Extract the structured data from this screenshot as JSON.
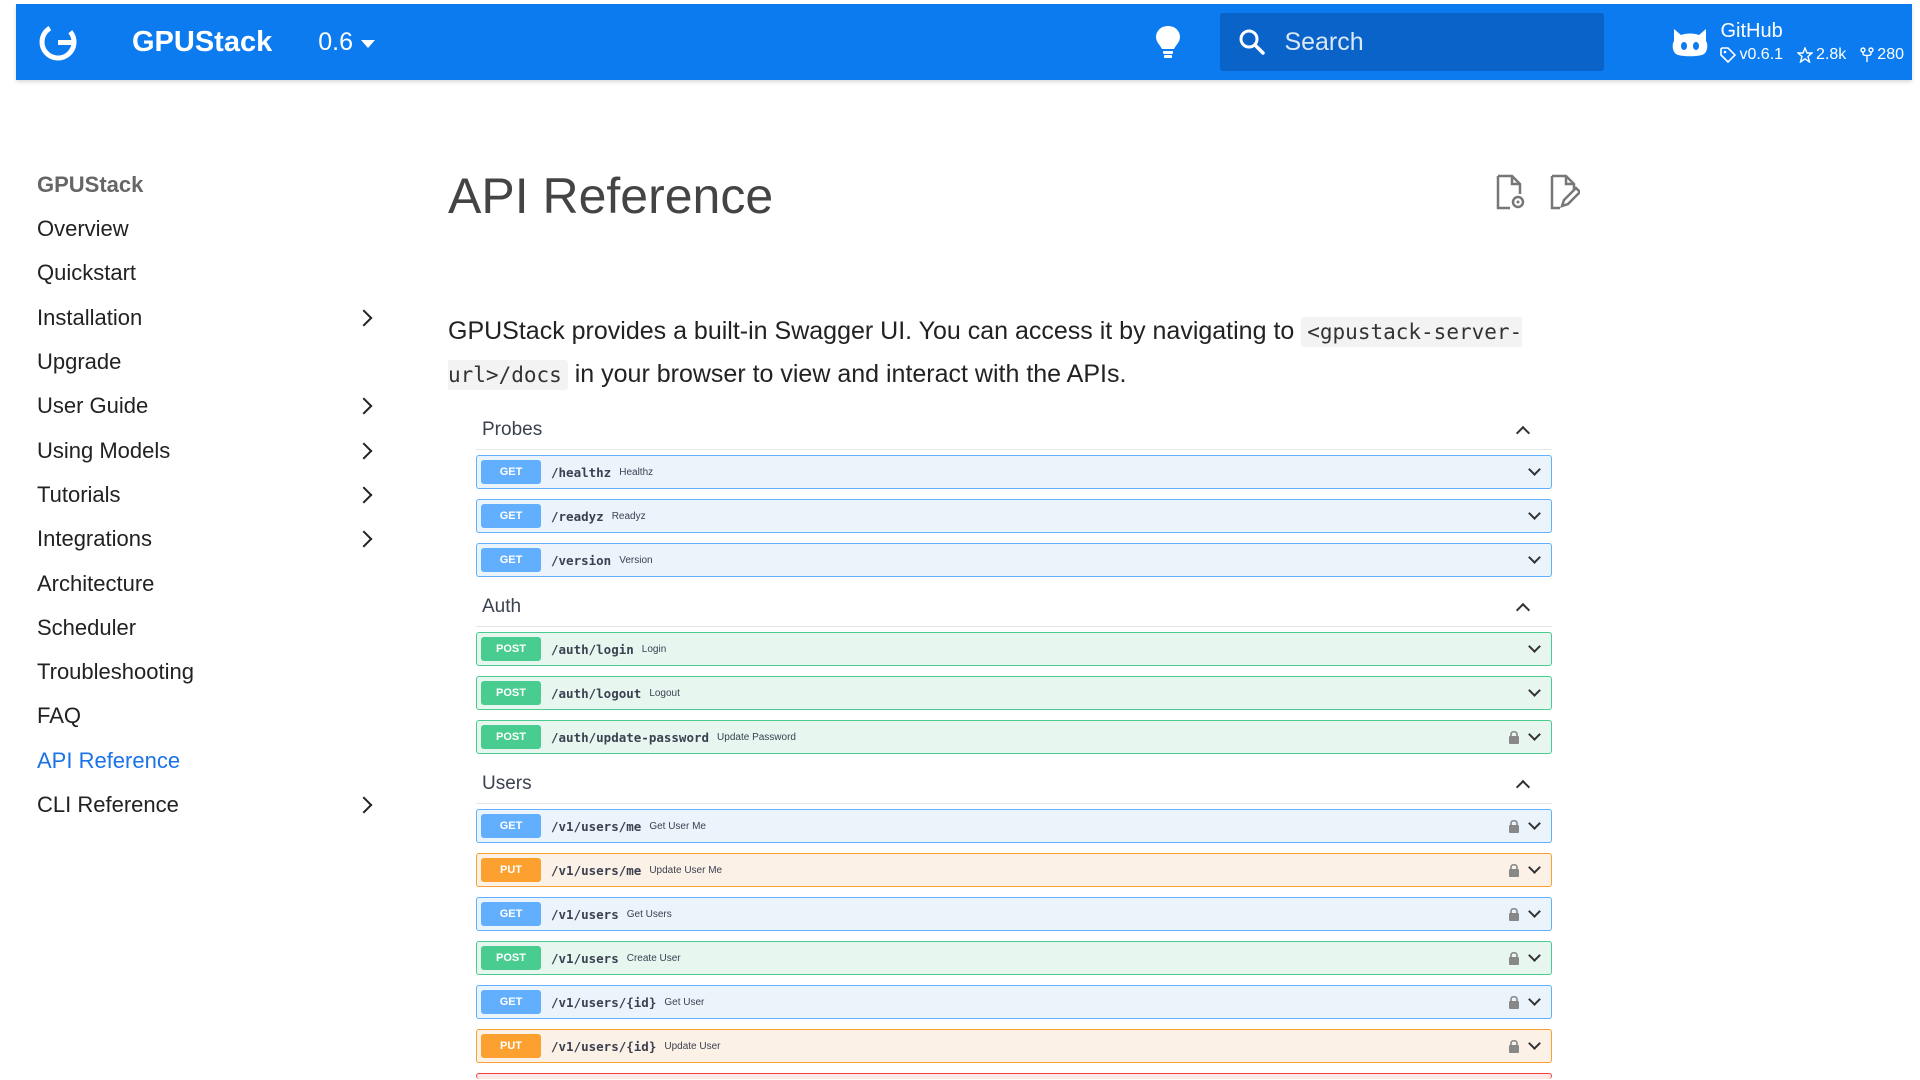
{
  "header": {
    "site_name": "GPUStack",
    "version": "0.6",
    "search_placeholder": "Search",
    "repo": {
      "name": "GitHub",
      "tag": "v0.6.1",
      "stars": "2.8k",
      "forks": "280"
    },
    "brand_color": "#0c7bf0"
  },
  "sidebar": {
    "title": "GPUStack",
    "items": [
      {
        "label": "Overview"
      },
      {
        "label": "Quickstart"
      },
      {
        "label": "Installation"
      },
      {
        "label": "Upgrade"
      },
      {
        "label": "User Guide"
      },
      {
        "label": "Using Models"
      },
      {
        "label": "Tutorials"
      },
      {
        "label": "Integrations"
      },
      {
        "label": "Architecture"
      },
      {
        "label": "Scheduler"
      },
      {
        "label": "Troubleshooting"
      },
      {
        "label": "FAQ"
      },
      {
        "label": "API Reference"
      },
      {
        "label": "CLI Reference"
      }
    ],
    "active_item": "API Reference"
  },
  "main": {
    "title": "API Reference",
    "intro": {
      "text_before": "GPUStack provides a built-in Swagger UI. You can access it by navigating to ",
      "code": "<gpustack-server-url>/docs",
      "text_after": " in your browser to view and interact with the APIs."
    }
  },
  "swagger": {
    "colors": {
      "get": "#61affe",
      "post": "#49cc90",
      "put": "#fca130"
    },
    "tags": [
      {
        "name": "Probes",
        "operations": [
          {
            "method": "GET",
            "path": "/healthz",
            "summary": "Healthz"
          },
          {
            "method": "GET",
            "path": "/readyz",
            "summary": "Readyz"
          },
          {
            "method": "GET",
            "path": "/version",
            "summary": "Version"
          }
        ]
      },
      {
        "name": "Auth",
        "operations": [
          {
            "method": "POST",
            "path": "/auth/login",
            "summary": "Login"
          },
          {
            "method": "POST",
            "path": "/auth/logout",
            "summary": "Logout"
          },
          {
            "method": "POST",
            "path": "/auth/update-password",
            "summary": "Update Password"
          }
        ]
      },
      {
        "name": "Users",
        "operations": [
          {
            "method": "GET",
            "path": "/v1/users/me",
            "summary": "Get User Me"
          },
          {
            "method": "PUT",
            "path": "/v1/users/me",
            "summary": "Update User Me"
          },
          {
            "method": "GET",
            "path": "/v1/users",
            "summary": "Get Users"
          },
          {
            "method": "POST",
            "path": "/v1/users",
            "summary": "Create User"
          },
          {
            "method": "GET",
            "path": "/v1/users/{id}",
            "summary": "Get User"
          },
          {
            "method": "PUT",
            "path": "/v1/users/{id}",
            "summary": "Update User"
          }
        ]
      }
    ]
  }
}
